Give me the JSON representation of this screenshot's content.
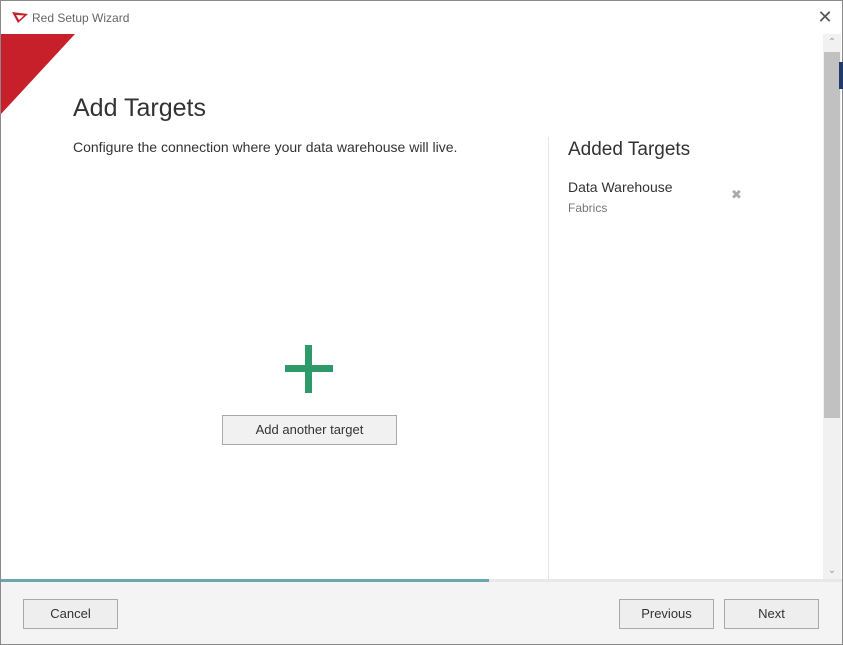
{
  "window": {
    "title": "Red Setup Wizard",
    "close_glyph": "✕",
    "brand_color": "#c8202a"
  },
  "page": {
    "heading": "Add Targets",
    "subtitle": "Configure the connection where your data warehouse will live."
  },
  "added_targets": {
    "title": "Added Targets",
    "items": [
      {
        "name": "Data Warehouse",
        "type": "Fabrics",
        "remove_icon": "✖"
      }
    ]
  },
  "add_target": {
    "icon": "plus-icon",
    "icon_color": "#2e9a6a",
    "button_label": "Add another target"
  },
  "progress": {
    "fraction": 0.58,
    "color": "#6aa8b0"
  },
  "footer": {
    "cancel_label": "Cancel",
    "previous_label": "Previous",
    "next_label": "Next"
  },
  "scrollbar": {
    "up_glyph": "⌃",
    "down_glyph": "⌄"
  }
}
